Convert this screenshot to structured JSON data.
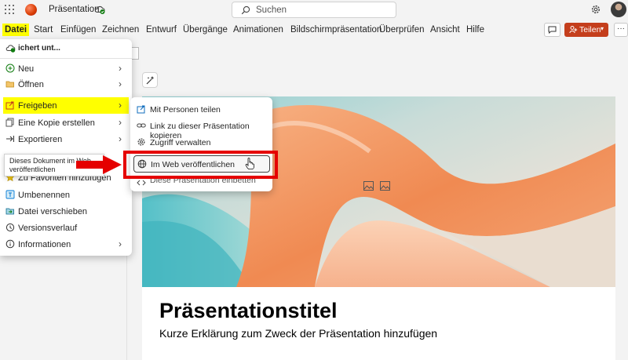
{
  "titlebar": {
    "doc_title": "Präsentation",
    "search_placeholder": "Suchen"
  },
  "ribbon": {
    "tabs": [
      "Datei",
      "Start",
      "Einfügen",
      "Zeichnen",
      "Entwurf",
      "Übergänge",
      "Animationen",
      "Bildschirmpräsentation",
      "Überprüfen",
      "Ansicht",
      "Hilfe"
    ],
    "active_tab": "Datei",
    "share_label": "Teilen",
    "more_label": "···"
  },
  "file_menu": {
    "autosave_text": "ichert unt...",
    "items": [
      {
        "label": "Neu",
        "icon": "plus-circle-icon",
        "arrow": true
      },
      {
        "label": "Öffnen",
        "icon": "folder-open-icon",
        "arrow": true
      },
      {
        "label": "Freigeben",
        "icon": "share-icon",
        "arrow": true,
        "highlighted": true
      },
      {
        "label": "Eine Kopie erstellen",
        "icon": "copy-icon",
        "arrow": true
      },
      {
        "label": "Exportieren",
        "icon": "export-icon",
        "arrow": true
      },
      {
        "label": "Zu Favoriten hinzufügen",
        "icon": "star-icon",
        "arrow": false
      },
      {
        "label": "Umbenennen",
        "icon": "rename-icon",
        "arrow": false
      },
      {
        "label": "Datei verschieben",
        "icon": "move-file-icon",
        "arrow": false
      },
      {
        "label": "Versionsverlauf",
        "icon": "history-icon",
        "arrow": false
      },
      {
        "label": "Informationen",
        "icon": "info-icon",
        "arrow": true
      }
    ]
  },
  "tooltip": {
    "text": "Dieses Dokument im Web veröffentlichen"
  },
  "share_submenu": {
    "items": [
      {
        "label": "Mit Personen teilen",
        "icon": "share-people-icon"
      },
      {
        "label": "Link zu dieser Präsentation kopieren",
        "icon": "link-icon"
      },
      {
        "label": "Zugriff verwalten",
        "icon": "settings-icon"
      },
      {
        "label": "Im Web veröffentlichen",
        "icon": "globe-icon",
        "selected": true
      },
      {
        "label": "Diese Präsentation einbetten",
        "icon": "embed-icon"
      }
    ]
  },
  "slide": {
    "title": "Präsentationstitel",
    "subtitle": "Kurze Erklärung zum Zweck der Präsentation hinzufügen"
  },
  "colors": {
    "accent": "#c43e1c",
    "highlight": "#ffff00",
    "annotation_red": "#e50000"
  }
}
